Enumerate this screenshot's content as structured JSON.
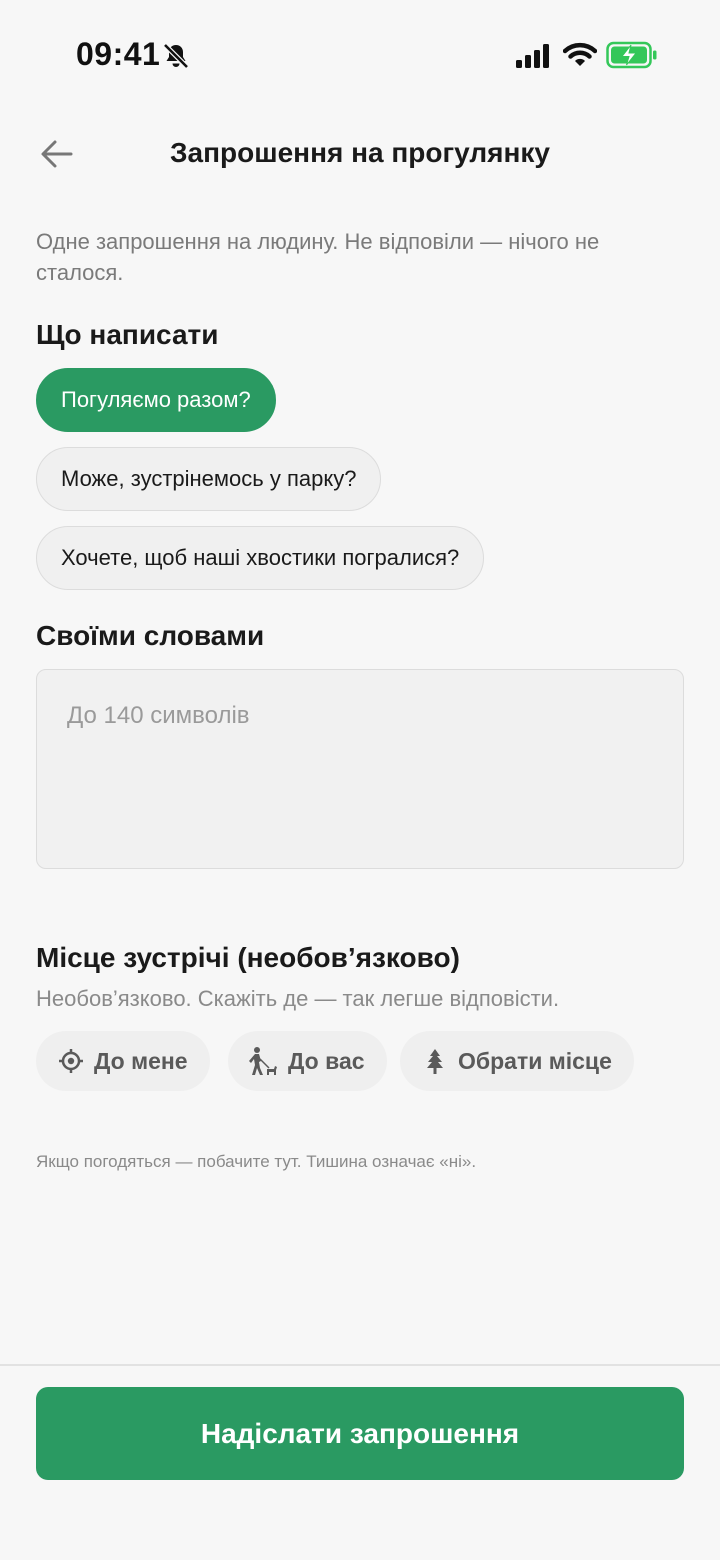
{
  "status_bar": {
    "time": "09:41",
    "icons": [
      "bell-slash-icon",
      "signal-icon",
      "wifi-icon",
      "battery-charging-icon"
    ],
    "battery_color": "#34c759"
  },
  "header": {
    "back_icon": "arrow-left-icon",
    "title": "Запрошення на прогулянку"
  },
  "intro": "Одне запрошення на людину. Не відповіли — нічого не сталося.",
  "message_section": {
    "heading": "Що написати",
    "options": [
      {
        "label": "Погуляємо разом?",
        "selected": true
      },
      {
        "label": "Може, зустрінемось у парку?",
        "selected": false
      },
      {
        "label": "Хочете, щоб наші хвостики погралися?",
        "selected": false
      }
    ]
  },
  "custom_section": {
    "heading": "Своїми словами",
    "placeholder": "До 140 символів",
    "value": ""
  },
  "place_section": {
    "heading": "Місце зустрічі (необов’язково)",
    "subtitle": "Необов’язково. Скажіть де — так легше відповісти.",
    "options": [
      {
        "label": "До мене",
        "icon": "target-icon"
      },
      {
        "label": "До вас",
        "icon": "person-walking-dog-icon"
      },
      {
        "label": "Обрати місце",
        "icon": "tree-icon"
      }
    ]
  },
  "footer_note": "Якщо погодяться — побачите тут. Тишина означає «ні».",
  "send_button": "Надіслати запрошення",
  "colors": {
    "accent": "#2a9a62",
    "background": "#f7f7f7",
    "muted_text": "#7a7a7a"
  }
}
